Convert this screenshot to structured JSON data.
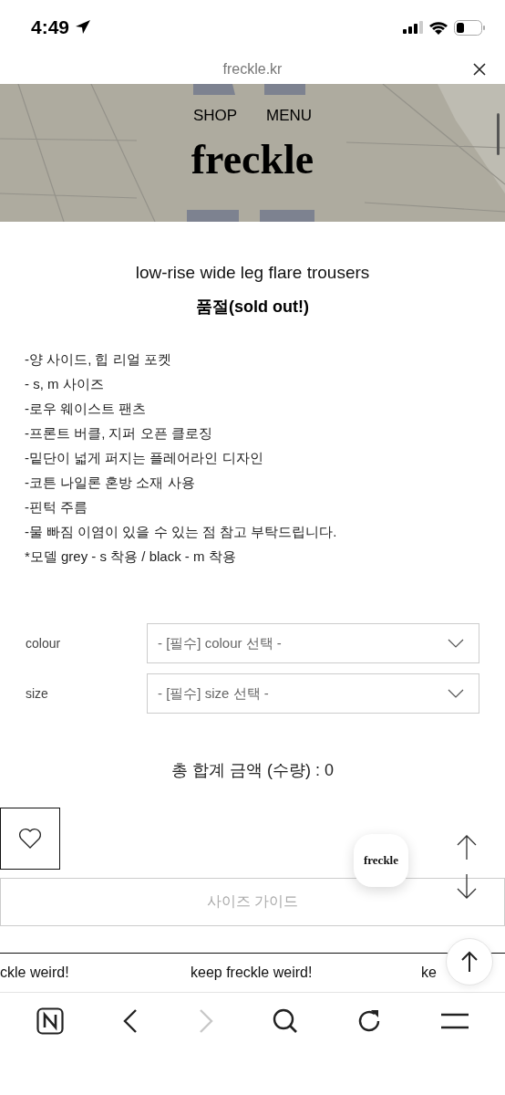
{
  "status_bar": {
    "time": "4:49"
  },
  "browser": {
    "url": "freckle.kr"
  },
  "site_nav": {
    "links": [
      "SHOP",
      "MENU"
    ],
    "logo": "freckle"
  },
  "product": {
    "title": "low-rise wide leg flare trousers",
    "status": "품절(sold out!)",
    "details": [
      "-양 사이드, 힙 리얼 포켓",
      "- s, m 사이즈",
      "-로우 웨이스트 팬츠",
      "-프론트 버클, 지퍼 오픈 클로징",
      "-밑단이 넓게 퍼지는 플레어라인 디자인",
      "-코튼 나일론 혼방 소재 사용",
      "-핀턱 주름",
      "-물 빠짐 이염이 있을 수 있는 점 참고 부탁드립니다.",
      "*모델 grey - s 착용 / black - m 착용"
    ]
  },
  "options": [
    {
      "label": "colour",
      "placeholder": "- [필수] colour 선택 -"
    },
    {
      "label": "size",
      "placeholder": "- [필수] size 선택 -"
    }
  ],
  "total": "총 합계 금액 (수량) : 0",
  "wishlist": {
    "selected": false
  },
  "size_guide_button": "사이즈 가이드",
  "chat_bubble": "freckle",
  "marquee": [
    "ckle weird!",
    "keep freckle weird!",
    "ke"
  ],
  "toolbar": {
    "forward_disabled": true
  }
}
